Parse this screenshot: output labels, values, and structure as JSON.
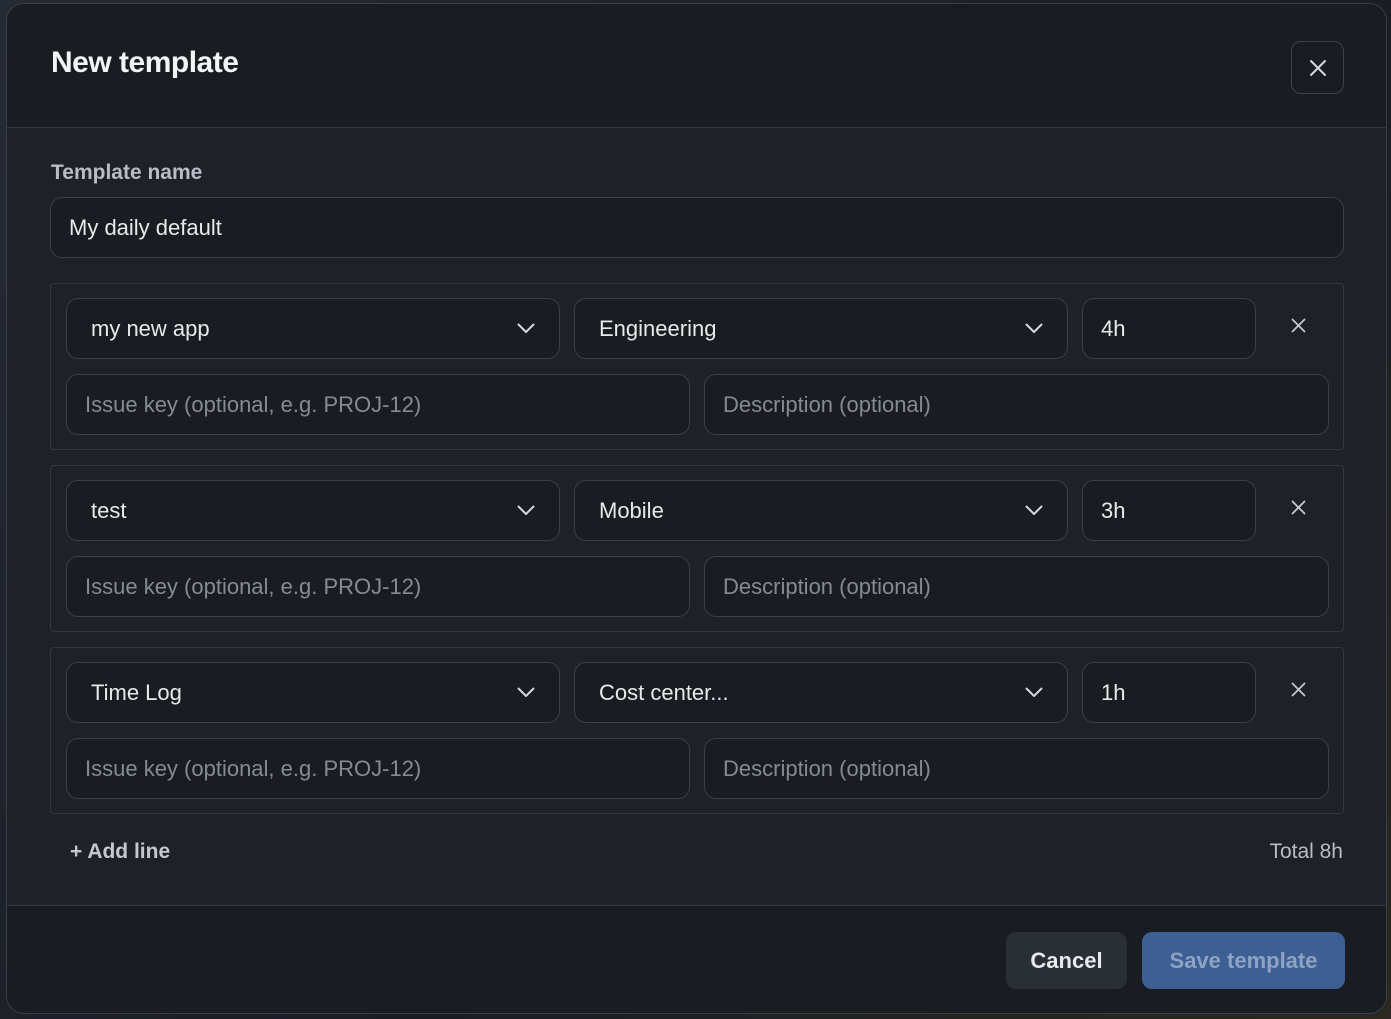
{
  "modal": {
    "title": "New template",
    "close_icon": "close-icon"
  },
  "form": {
    "name_label": "Template name",
    "name_value": "My daily default"
  },
  "lines": [
    {
      "project": "my new app",
      "cost_center": "Engineering",
      "hours": "4h",
      "issue_placeholder": "Issue key (optional, e.g. PROJ-12)",
      "description_placeholder": "Description (optional)"
    },
    {
      "project": "test",
      "cost_center": "Mobile",
      "hours": "3h",
      "issue_placeholder": "Issue key (optional, e.g. PROJ-12)",
      "description_placeholder": "Description (optional)"
    },
    {
      "project": "Time Log",
      "cost_center": "Cost center...",
      "hours": "1h",
      "issue_placeholder": "Issue key (optional, e.g. PROJ-12)",
      "description_placeholder": "Description (optional)"
    }
  ],
  "actions": {
    "add_line": "+ Add line",
    "total": "Total 8h",
    "cancel": "Cancel",
    "save": "Save template"
  },
  "colors": {
    "background": "#1e2127",
    "header_footer": "#191c21",
    "save_button": "#3e5f94",
    "border": "#3a3f48"
  }
}
